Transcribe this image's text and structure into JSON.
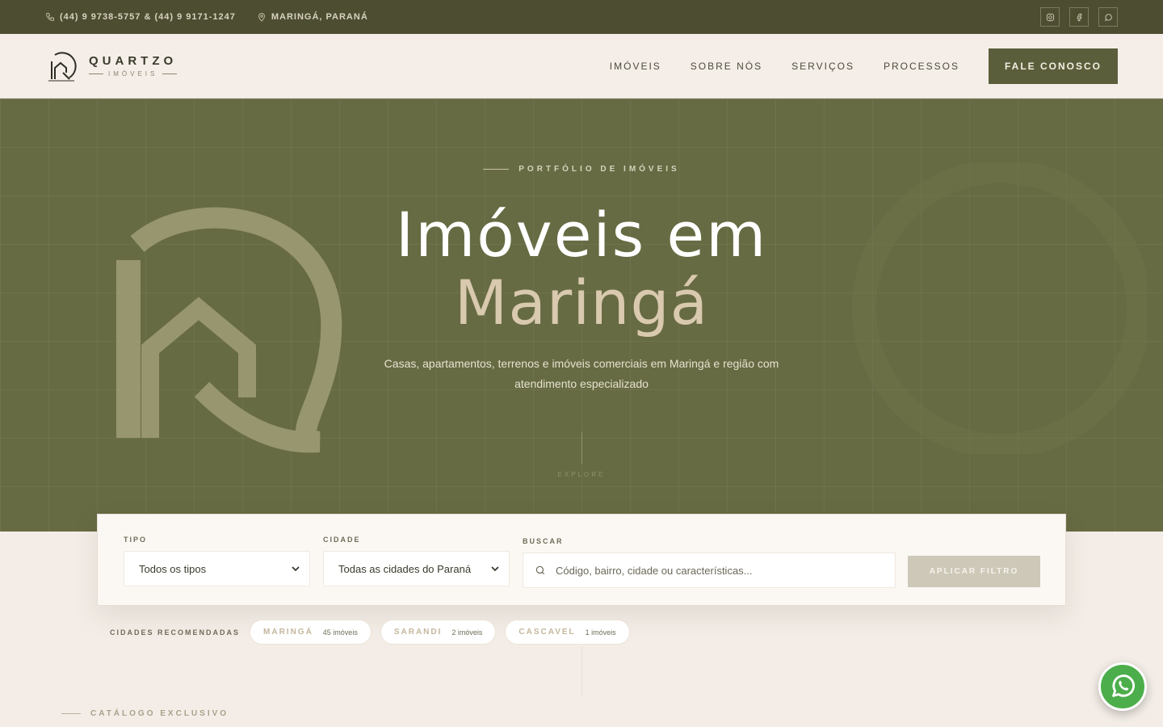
{
  "topbar": {
    "phone": "(44) 9 9738-5757 & (44) 9 9171-1247",
    "location": "MARINGÁ, PARANÁ",
    "socials": [
      "instagram-icon",
      "facebook-icon",
      "whatsapp-chat-icon"
    ]
  },
  "header": {
    "brand": "QUARTZO",
    "brand_sub": "IMÓVEIS",
    "nav": [
      "IMÓVEIS",
      "SOBRE NÓS",
      "SERVIÇOS",
      "PROCESSOS"
    ],
    "cta": "FALE CONOSCO"
  },
  "hero": {
    "eyebrow": "PORTFÓLIO DE IMÓVEIS",
    "title_line1": "Imóveis em",
    "title_line2": "Maringá",
    "description": "Casas, apartamentos, terrenos e imóveis comerciais em Maringá e região com atendimento especializado",
    "explore": "EXPLORE"
  },
  "filter": {
    "tipo_label": "TIPO",
    "tipo_value": "Todos os tipos",
    "cidade_label": "CIDADE",
    "cidade_value": "Todas as cidades do Paraná",
    "buscar_label": "BUSCAR",
    "buscar_placeholder": "Código, bairro, cidade ou características...",
    "apply": "APLICAR FILTRO"
  },
  "cities": {
    "label": "CIDADES RECOMENDADAS",
    "items": [
      {
        "name": "MARINGÁ",
        "count": "45 imóveis"
      },
      {
        "name": "SARANDI",
        "count": "2 imóveis"
      },
      {
        "name": "CASCAVEL",
        "count": "1 imóveis"
      }
    ]
  },
  "catalog": "CATÁLOGO EXCLUSIVO",
  "colors": {
    "topbar": "#4d4d32",
    "hero": "#676b43",
    "accent": "#5b5e3b",
    "gold": "#d9c9ae",
    "whatsapp": "#4cae4a"
  }
}
